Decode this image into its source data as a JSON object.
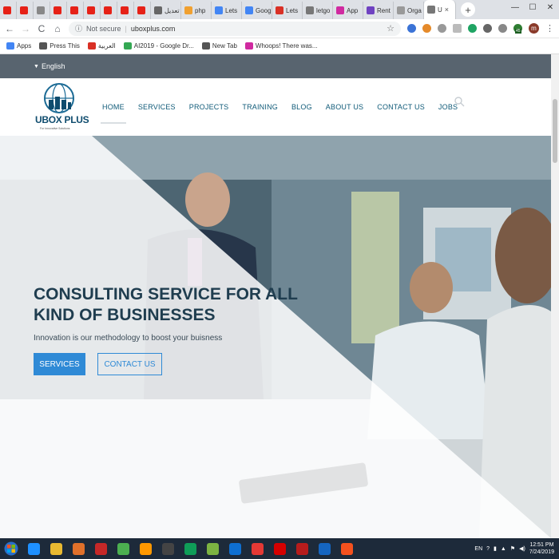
{
  "browser": {
    "tabs": [
      {
        "label": "",
        "color": "#e62117"
      },
      {
        "label": "",
        "color": "#e62117"
      },
      {
        "label": "",
        "color": "#888888"
      },
      {
        "label": "",
        "color": "#e62117"
      },
      {
        "label": "",
        "color": "#e62117"
      },
      {
        "label": "",
        "color": "#e62117"
      },
      {
        "label": "",
        "color": "#e62117"
      },
      {
        "label": "",
        "color": "#e62117"
      },
      {
        "label": "",
        "color": "#e62117"
      },
      {
        "label": "تعديل",
        "color": "#666666"
      },
      {
        "label": "php",
        "color": "#f0a030"
      },
      {
        "label": "Lets",
        "color": "#4285f4"
      },
      {
        "label": "Goog",
        "color": "#4285f4"
      },
      {
        "label": "Lets",
        "color": "#d93025"
      },
      {
        "label": "letgo",
        "color": "#777777"
      },
      {
        "label": "App",
        "color": "#d02aa0"
      },
      {
        "label": "Rent",
        "color": "#6f42c1"
      },
      {
        "label": "Orga",
        "color": "#999999"
      },
      {
        "label": "U",
        "color": "#777777",
        "active": true
      }
    ],
    "new_tab": "+",
    "window_controls": {
      "minimize": "—",
      "maximize": "☐",
      "close": "✕"
    },
    "nav": {
      "back": "←",
      "forward": "→",
      "reload": "C",
      "home": "⌂"
    },
    "security": "Not secure",
    "url": "uboxplus.com",
    "star": "☆",
    "avatar": "m",
    "extension_badge": "45",
    "bookmarks": [
      {
        "label": "Apps",
        "color": "#4285f4"
      },
      {
        "label": "Press This",
        "color": "#555555"
      },
      {
        "label": "العربية",
        "color": "#d93025"
      },
      {
        "label": "AI2019 - Google Dr...",
        "color": "#34a853"
      },
      {
        "label": "New Tab",
        "color": "#555555"
      },
      {
        "label": "Whoops! There was...",
        "color": "#d02aa0"
      }
    ]
  },
  "site": {
    "language": "English",
    "logo_text": "UBOX PLUS",
    "logo_tagline": "For Innovative Solutions",
    "nav": [
      "HOME",
      "SERVICES",
      "PROJECTS",
      "TRAINING",
      "BLOG",
      "ABOUT US",
      "CONTACT US",
      "JOBS"
    ],
    "hero": {
      "heading_line1": "CONSULTING SERVICE FOR ALL",
      "heading_line2": "KIND OF BUSINESSES",
      "subtitle": "Innovation is our methodology to boost your buisness",
      "primary_button": "SERVICES",
      "secondary_button": "CONTACT US"
    },
    "colors": {
      "accent": "#2f8ad6",
      "topbar": "#58646f",
      "nav_text": "#0f5a78",
      "heading": "#1f3d4f"
    }
  },
  "taskbar": {
    "apps": [
      "ie",
      "explorer",
      "media",
      "zynga",
      "chrome",
      "sublime",
      "terminal",
      "hangouts",
      "android",
      "teamviewer",
      "anydesk",
      "opera",
      "filezilla",
      "notepad",
      "swift"
    ],
    "tray": {
      "language": "EN",
      "time": "12:51 PM",
      "date": "7/24/2019"
    }
  }
}
